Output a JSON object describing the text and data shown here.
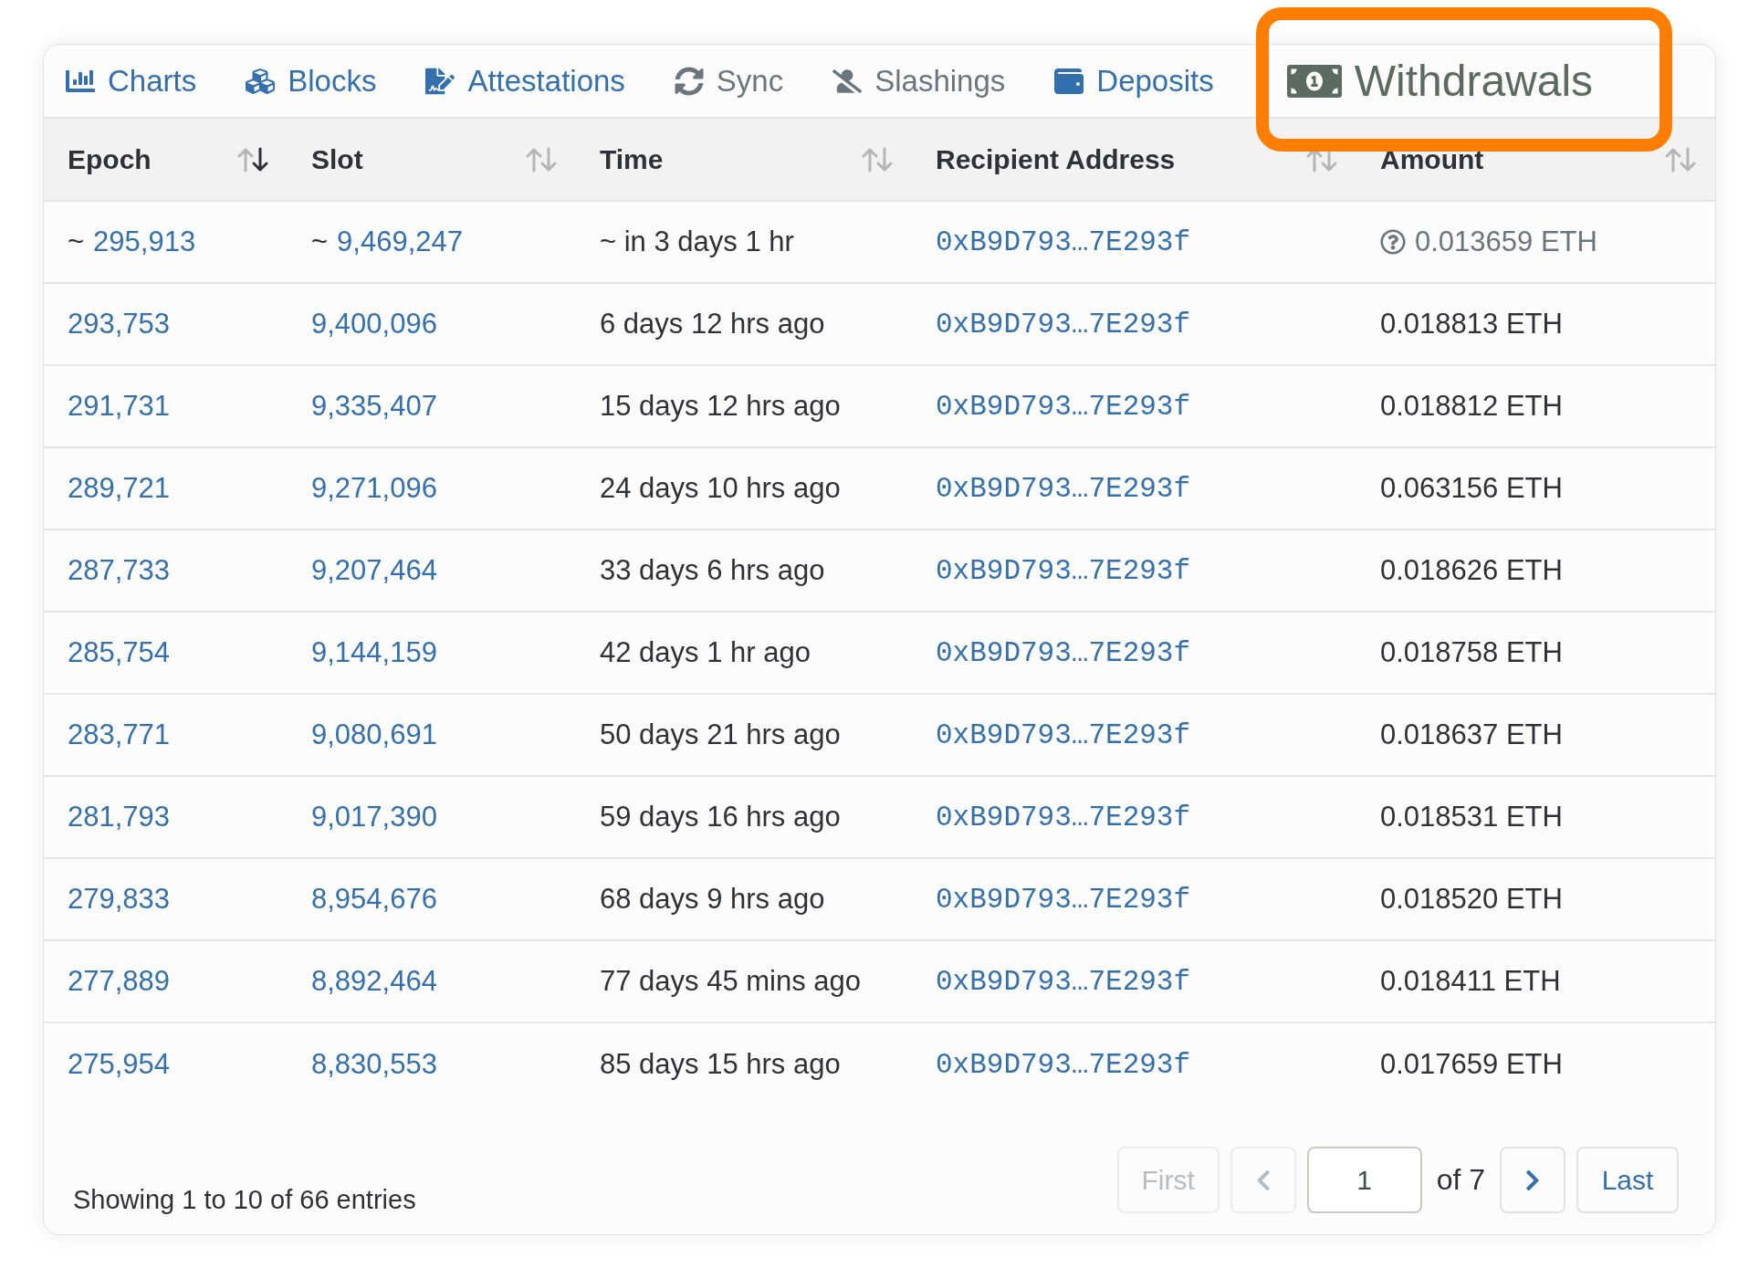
{
  "tabs": [
    {
      "label": "Charts",
      "selected": false,
      "disabled": false
    },
    {
      "label": "Blocks",
      "selected": false,
      "disabled": false
    },
    {
      "label": "Attestations",
      "selected": false,
      "disabled": false
    },
    {
      "label": "Sync",
      "selected": false,
      "disabled": true
    },
    {
      "label": "Slashings",
      "selected": false,
      "disabled": true
    },
    {
      "label": "Deposits",
      "selected": false,
      "disabled": false
    },
    {
      "label": "Withdrawals",
      "selected": true,
      "disabled": false
    }
  ],
  "table": {
    "columns": [
      {
        "label": "Epoch",
        "sorted": true
      },
      {
        "label": "Slot",
        "sorted": false
      },
      {
        "label": "Time",
        "sorted": false
      },
      {
        "label": "Recipient Address",
        "sorted": false
      },
      {
        "label": "Amount",
        "sorted": false
      }
    ],
    "rows": [
      {
        "pending": true,
        "approx_mark": "~",
        "epoch": "295,913",
        "slot": "9,469,247",
        "time": "~ in 3 days 1 hr",
        "address": "0xB9D793…7E293f",
        "amount": "0.013659 ETH"
      },
      {
        "pending": false,
        "epoch": "293,753",
        "slot": "9,400,096",
        "time": "6 days 12 hrs ago",
        "address": "0xB9D793…7E293f",
        "amount": "0.018813 ETH"
      },
      {
        "pending": false,
        "epoch": "291,731",
        "slot": "9,335,407",
        "time": "15 days 12 hrs ago",
        "address": "0xB9D793…7E293f",
        "amount": "0.018812 ETH"
      },
      {
        "pending": false,
        "epoch": "289,721",
        "slot": "9,271,096",
        "time": "24 days 10 hrs ago",
        "address": "0xB9D793…7E293f",
        "amount": "0.063156 ETH"
      },
      {
        "pending": false,
        "epoch": "287,733",
        "slot": "9,207,464",
        "time": "33 days 6 hrs ago",
        "address": "0xB9D793…7E293f",
        "amount": "0.018626 ETH"
      },
      {
        "pending": false,
        "epoch": "285,754",
        "slot": "9,144,159",
        "time": "42 days 1 hr ago",
        "address": "0xB9D793…7E293f",
        "amount": "0.018758 ETH"
      },
      {
        "pending": false,
        "epoch": "283,771",
        "slot": "9,080,691",
        "time": "50 days 21 hrs ago",
        "address": "0xB9D793…7E293f",
        "amount": "0.018637 ETH"
      },
      {
        "pending": false,
        "epoch": "281,793",
        "slot": "9,017,390",
        "time": "59 days 16 hrs ago",
        "address": "0xB9D793…7E293f",
        "amount": "0.018531 ETH"
      },
      {
        "pending": false,
        "epoch": "279,833",
        "slot": "8,954,676",
        "time": "68 days 9 hrs ago",
        "address": "0xB9D793…7E293f",
        "amount": "0.018520 ETH"
      },
      {
        "pending": false,
        "epoch": "277,889",
        "slot": "8,892,464",
        "time": "77 days 45 mins ago",
        "address": "0xB9D793…7E293f",
        "amount": "0.018411 ETH"
      },
      {
        "pending": false,
        "epoch": "275,954",
        "slot": "8,830,553",
        "time": "85 days 15 hrs ago",
        "address": "0xB9D793…7E293f",
        "amount": "0.017659 ETH"
      }
    ]
  },
  "footer": {
    "summary": "Showing 1 to 10 of 66 entries",
    "pagination": {
      "first": {
        "label": "First",
        "disabled": true
      },
      "prev_disabled": true,
      "page": "1",
      "of_label": "of 7",
      "next_disabled": false,
      "last": {
        "label": "Last",
        "disabled": false
      }
    }
  }
}
